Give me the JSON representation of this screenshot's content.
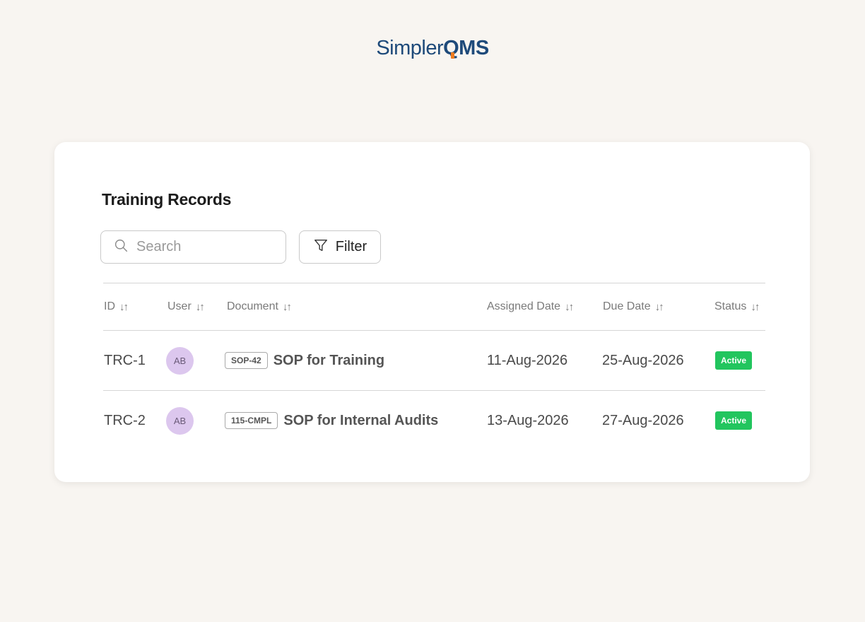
{
  "brand": {
    "name_light": "Simpler",
    "name_bold": "QMS"
  },
  "page": {
    "title": "Training Records"
  },
  "search": {
    "placeholder": "Search",
    "value": ""
  },
  "filter": {
    "label": "Filter"
  },
  "table": {
    "columns": [
      "ID",
      "User",
      "Document",
      "Assigned Date",
      "Due Date",
      "Status"
    ],
    "rows": [
      {
        "id": "TRC-1",
        "user_initials": "AB",
        "doc_code": "SOP-42",
        "doc_title": "SOP for Training",
        "assigned_date": "11-Aug-2026",
        "due_date": "25-Aug-2026",
        "status": "Active"
      },
      {
        "id": "TRC-2",
        "user_initials": "AB",
        "doc_code": "115-CMPL",
        "doc_title": "SOP for Internal Audits",
        "assigned_date": "13-Aug-2026",
        "due_date": "27-Aug-2026",
        "status": "Active"
      }
    ]
  },
  "colors": {
    "background": "#f8f5f1",
    "brand_blue": "#1e4a7a",
    "brand_orange": "#f07c1e",
    "status_active": "#22c55e",
    "avatar": "#dcc7ee"
  },
  "icons": {
    "search": "search-icon",
    "filter": "filter-icon",
    "sort": "sort-icon"
  }
}
